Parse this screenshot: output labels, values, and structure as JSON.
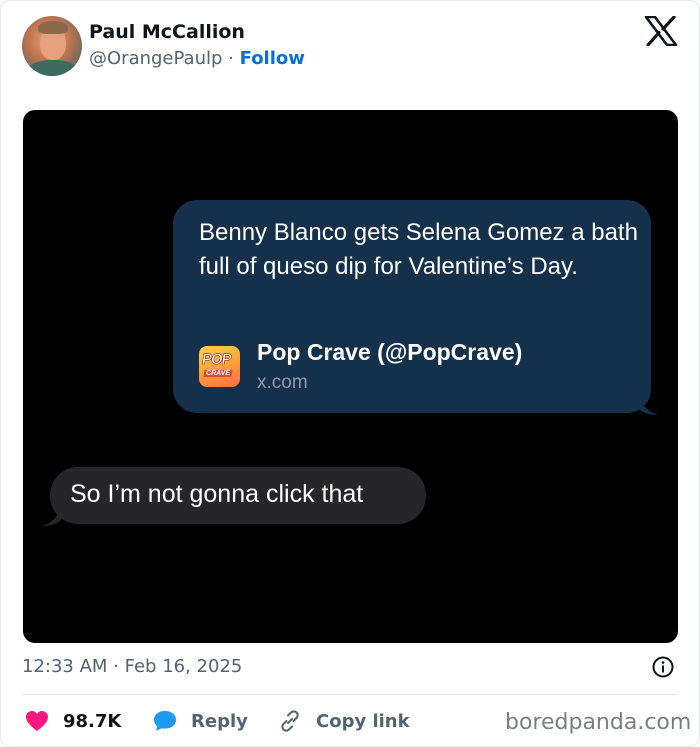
{
  "author": {
    "name": "Paul McCallion",
    "handle": "@OrangePaulp",
    "separator": "·",
    "follow_label": "Follow"
  },
  "platform_icon": "x-logo-icon",
  "media": {
    "outgoing_message": "Benny Blanco gets Selena Gomez a bath full of queso dip for Valentine’s Day.",
    "link_preview": {
      "title": "Pop Crave (@PopCrave)",
      "domain": "x.com",
      "logo_text_top": "POP",
      "logo_text_bottom": "CRAVE"
    },
    "incoming_message": "So I’m not gonna click that"
  },
  "meta": {
    "timestamp": "12:33 AM · Feb 16, 2025"
  },
  "actions": {
    "like_count": "98.7K",
    "reply_label": "Reply",
    "copy_link_label": "Copy link"
  },
  "watermark": "boredpanda.com",
  "colors": {
    "follow": "#0a6fd9",
    "like": "#f91880",
    "reply_icon": "#1d9bf0",
    "outgoing_bubble": "#14304a",
    "incoming_bubble": "#262628"
  }
}
